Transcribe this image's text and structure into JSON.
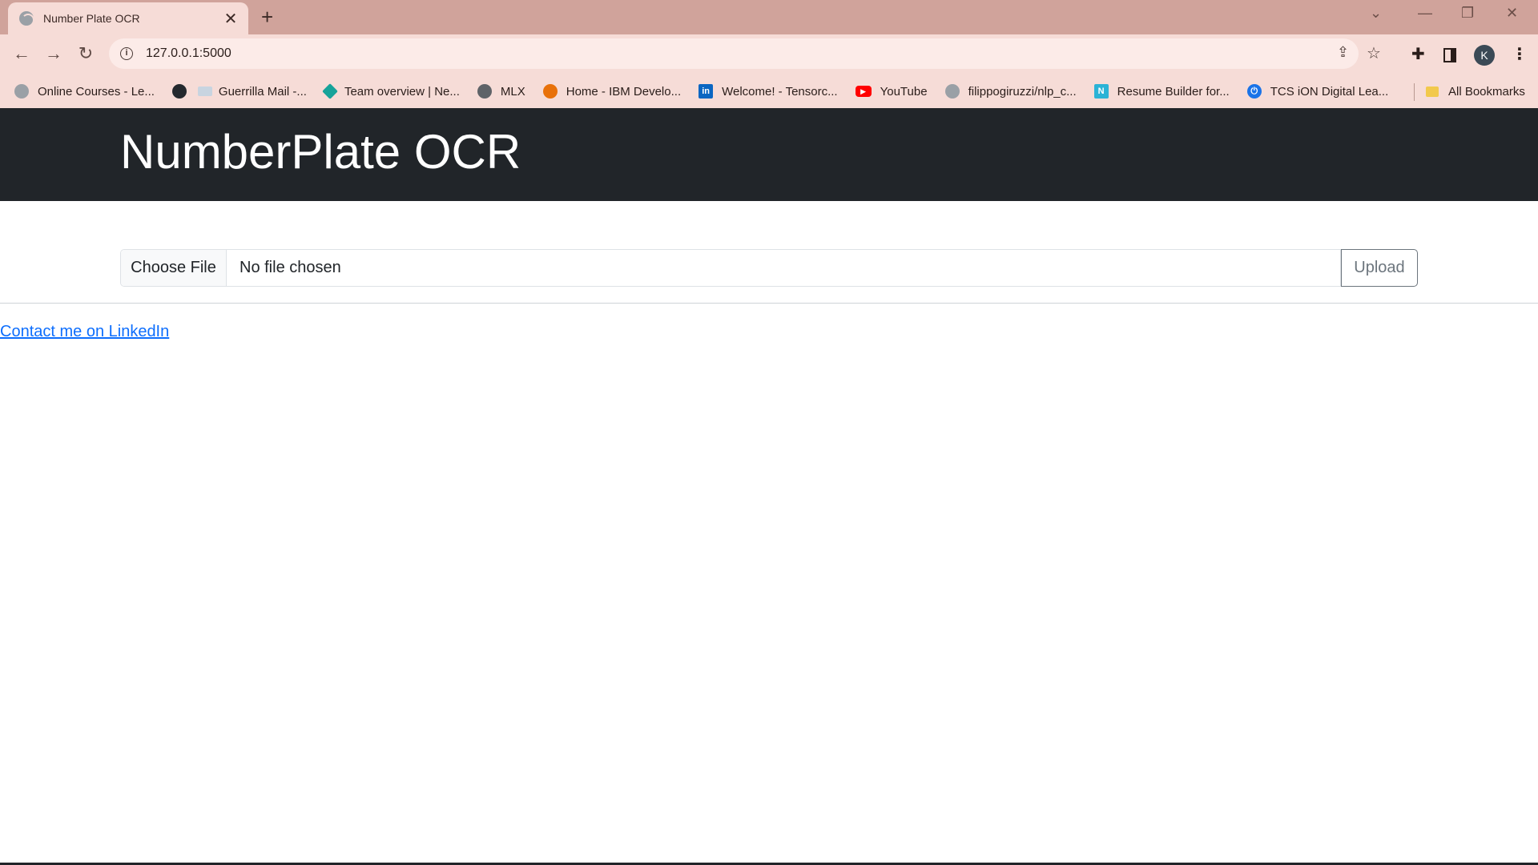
{
  "browser": {
    "tab_title": "Number Plate OCR",
    "tab_close": "✕",
    "new_tab": "+",
    "url": "127.0.0.1:5000",
    "profile_initial": "K",
    "bookmarks": [
      {
        "label": "Online Courses - Le...",
        "icon": "github-icon"
      },
      {
        "label": "",
        "icon": "github-icon"
      },
      {
        "label": "Guerrilla Mail -...",
        "icon": "mail-icon"
      },
      {
        "label": "Team overview | Ne...",
        "icon": "diamond-icon"
      },
      {
        "label": "MLX",
        "icon": "globe-icon"
      },
      {
        "label": "Home - IBM Develo...",
        "icon": "ibm-icon"
      },
      {
        "label": "Welcome! - Tensorc...",
        "icon": "linkedin-icon"
      },
      {
        "label": "YouTube",
        "icon": "youtube-icon"
      },
      {
        "label": "filippogiruzzi/nlp_c...",
        "icon": "github-icon"
      },
      {
        "label": "Resume Builder for...",
        "icon": "resume-icon"
      },
      {
        "label": "TCS iON Digital Lea...",
        "icon": "power-icon"
      }
    ],
    "all_bookmarks": "All Bookmarks"
  },
  "page": {
    "brand": "NumberPlate OCR",
    "choose_file": "Choose File",
    "file_status": "No file chosen",
    "upload": "Upload",
    "contact_link": "Contact me on LinkedIn"
  }
}
